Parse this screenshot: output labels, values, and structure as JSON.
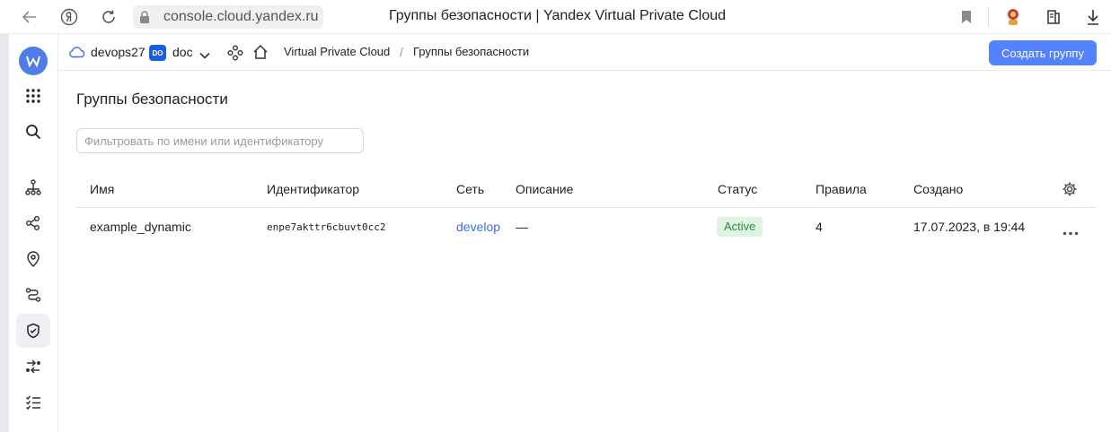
{
  "browser": {
    "url": "console.cloud.yandex.ru",
    "tab_title": "Группы безопасности | Yandex Virtual Private Cloud"
  },
  "header": {
    "cloud_name": "devops27",
    "folder_badge": "DO",
    "folder_name": "doc",
    "breadcrumb_service": "Virtual Private Cloud",
    "breadcrumb_separator": "/",
    "breadcrumb_current": "Группы безопасности",
    "create_button": "Создать группу"
  },
  "page": {
    "title": "Группы безопасности",
    "filter_placeholder": "Фильтровать по имени или идентификатору",
    "filter_value": ""
  },
  "table": {
    "columns": [
      "Имя",
      "Идентификатор",
      "Сеть",
      "Описание",
      "Статус",
      "Правила",
      "Создано"
    ],
    "rows": [
      {
        "name": "example_dynamic",
        "id": "enpe7akttr6cbuvt0cc2",
        "network": "develop",
        "description": "—",
        "status": "Active",
        "rules": "4",
        "created": "17.07.2023, в 19:44"
      }
    ]
  },
  "colors": {
    "accent": "#5282ff",
    "link": "#3b6ee8",
    "status_active_bg": "#dff3e2",
    "status_active_text": "#2d8a3e"
  },
  "icons": [
    "back-arrow-icon",
    "yandex-icon",
    "reload-icon",
    "lock-icon",
    "bookmark-icon",
    "extension-icon",
    "collections-icon",
    "download-icon",
    "cloud-icon",
    "chevron-down-icon",
    "services-icon",
    "home-icon",
    "grid-icon",
    "search-icon",
    "network-icon",
    "share-icon",
    "location-icon",
    "routes-icon",
    "shield-icon",
    "gateway-icon",
    "checklist-icon",
    "settings-gear-icon",
    "more-icon"
  ]
}
